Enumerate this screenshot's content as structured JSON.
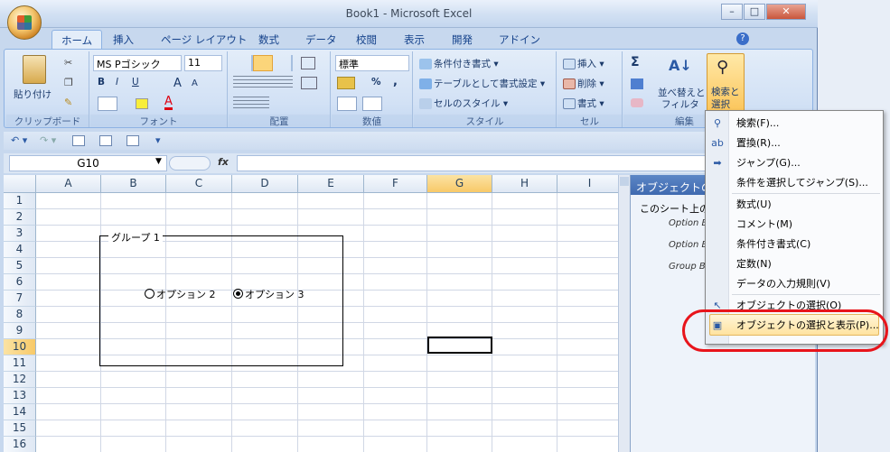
{
  "window": {
    "title": "Book1 - Microsoft Excel",
    "min": "–",
    "max": "□",
    "close": "✕"
  },
  "tabs": [
    "ホーム",
    "挿入",
    "ページ レイアウト",
    "数式",
    "データ",
    "校閲",
    "表示",
    "開発",
    "アドイン"
  ],
  "ribbon": {
    "clipboard": {
      "paste": "貼り付け",
      "label": "クリップボード"
    },
    "font": {
      "name": "MS Pゴシック",
      "size": "11",
      "bold": "B",
      "italic": "I",
      "underline": "U",
      "grow": "A",
      "shrink": "A",
      "color_a": "A",
      "label": "フォント"
    },
    "align": {
      "label": "配置"
    },
    "number": {
      "format": "標準",
      "label": "数値",
      "percent": "%",
      "comma": ","
    },
    "style": {
      "cond": "条件付き書式",
      "table": "テーブルとして書式設定",
      "cell": "セルのスタイル",
      "label": "スタイル"
    },
    "cells": {
      "insert": "挿入",
      "delete": "削除",
      "format": "書式",
      "label": "セル"
    },
    "edit": {
      "sum": "Σ",
      "sort": "並べ替えと",
      "filter": "フィルタ",
      "find": "検索と",
      "select": "選択",
      "label": "編集"
    }
  },
  "formula_bar": {
    "name_box": "G10",
    "fx": "fx",
    "value": ""
  },
  "sheet": {
    "columns": [
      "A",
      "B",
      "C",
      "D",
      "E",
      "F",
      "G",
      "H",
      "I"
    ],
    "rows": [
      "1",
      "2",
      "3",
      "4",
      "5",
      "6",
      "7",
      "8",
      "9",
      "10",
      "11",
      "12",
      "13",
      "14",
      "15",
      "16"
    ],
    "selected_cell": "G10",
    "group_title": "グループ 1",
    "option2": "オプション 2",
    "option3": "オプション 3"
  },
  "pane": {
    "title": "オブジェクトの",
    "heading": "このシート上の",
    "items": [
      "Option B",
      "Option B",
      "Group B"
    ]
  },
  "menu": {
    "items": [
      "検索(F)...",
      "置換(R)...",
      "ジャンプ(G)...",
      "条件を選択してジャンプ(S)...",
      "数式(U)",
      "コメント(M)",
      "条件付き書式(C)",
      "定数(N)",
      "データの入力規則(V)",
      "オブジェクトの選択(O)",
      "オブジェクトの選択と表示(P)..."
    ]
  },
  "colors": {
    "highlight_oval": "#e8141b",
    "selected_header": "#f8c968"
  }
}
